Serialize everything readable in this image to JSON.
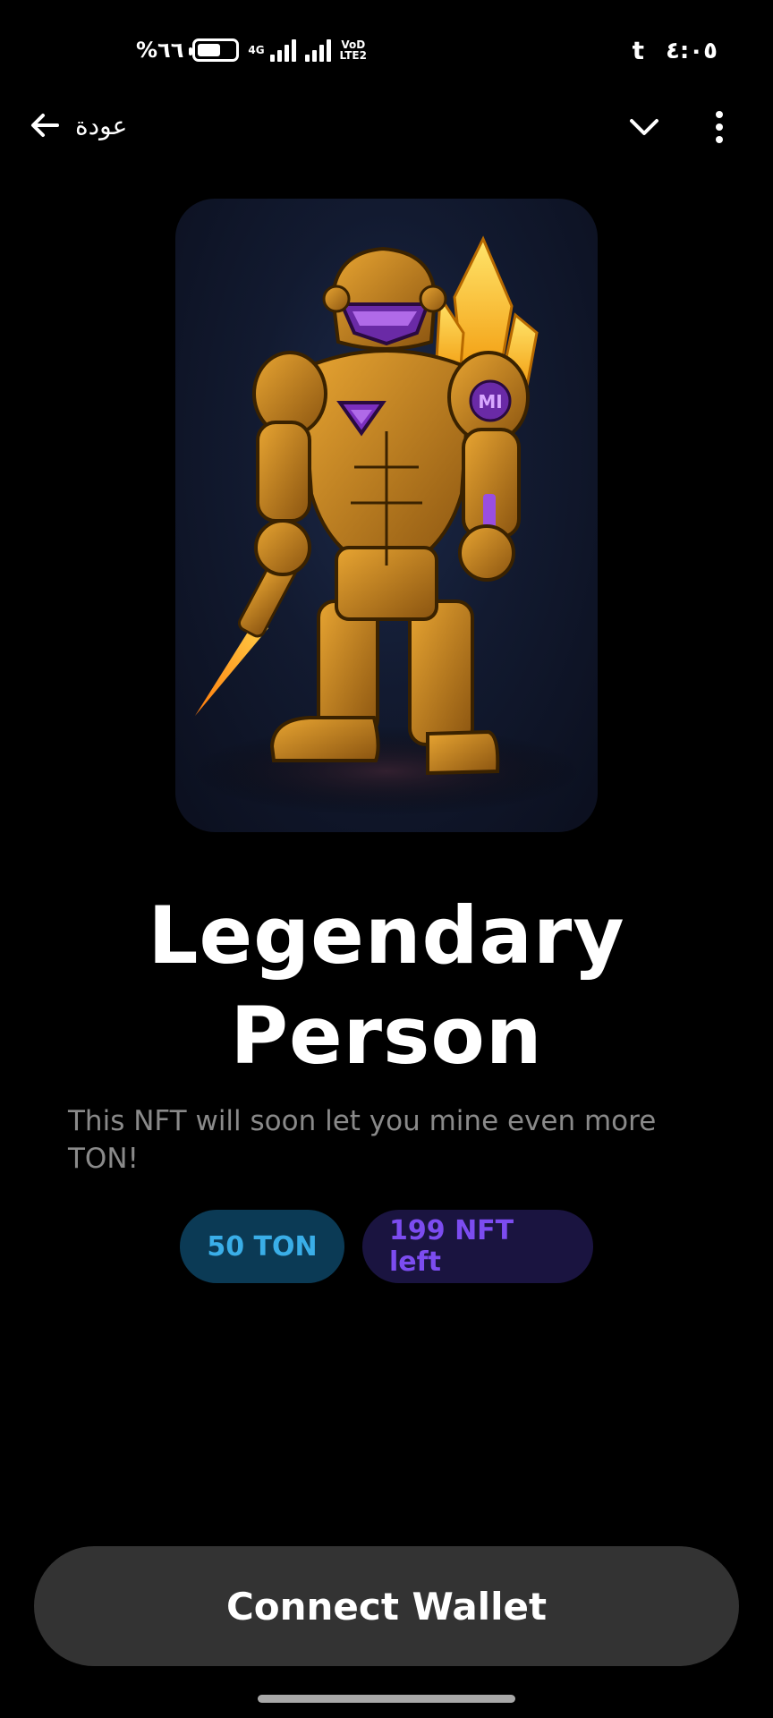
{
  "status_bar": {
    "battery_percent": "%٦٦",
    "battery_level": 0.66,
    "network_type": "4G",
    "volte_top": "VoD",
    "volte_bottom": "LTE2",
    "tumblr_glyph": "t",
    "clock": "٤:٠٥"
  },
  "nav": {
    "back_label": "عودة",
    "back_icon": "arrow-left-icon",
    "collapse_icon": "chevron-down-icon",
    "menu_icon": "more-vertical-icon"
  },
  "nft": {
    "image_description_icon": "nft-armored-robot-image",
    "emblem_text": "MI",
    "title": "Legendary Person",
    "description": "This NFT will soon let you mine even more TON!",
    "price": "50 TON",
    "supply_left": "199 NFT left"
  },
  "actions": {
    "connect_label": "Connect Wallet"
  },
  "colors": {
    "background": "#000000",
    "price_badge_bg": "#0b3a55",
    "price_badge_text": "#3aaee8",
    "supply_badge_bg": "#1a1440",
    "supply_badge_text": "#7c4cf0",
    "button_bg": "#333333",
    "armor_gold": "#c98a1e",
    "visor_purple": "#7b2fbf",
    "crystal_yellow": "#ffc21a"
  }
}
